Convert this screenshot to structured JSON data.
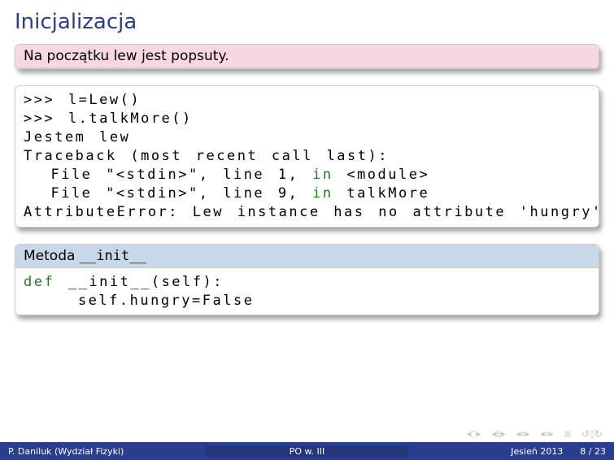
{
  "title": "Inicjalizacja",
  "block1": {
    "head": "Na początku lew jest popsuty."
  },
  "code1": {
    "l1": ">>> l=Lew()",
    "l2": ">>> l.talkMore()",
    "l3": "Jestem lew",
    "l4": "Traceback (most recent call last):",
    "l5a": "  File \"<stdin>\", line 1, ",
    "l5kw": "in",
    "l5b": " <module>",
    "l6a": "  File \"<stdin>\", line 9, ",
    "l6kw": "in",
    "l6b": " talkMore",
    "l7": "AttributeError: Lew instance has no attribute 'hungry'"
  },
  "block3": {
    "head_pre": "Metoda ",
    "head_code": "__init__"
  },
  "code3": {
    "l1kw": "def",
    "l1b": " __init__(self):",
    "l2": "    self.hungry=False"
  },
  "nav": {
    "first": "◂□▸",
    "prevsec": "◂▤▸",
    "prev": "◂≡▸",
    "next": "◂≡▸",
    "mode": "≣",
    "redo": "↺◊↻"
  },
  "footer": {
    "author": "P. Daniluk (Wydział Fizyki)",
    "center": "PO w. III",
    "term": "Jesień 2013",
    "page": "8 / 23"
  }
}
